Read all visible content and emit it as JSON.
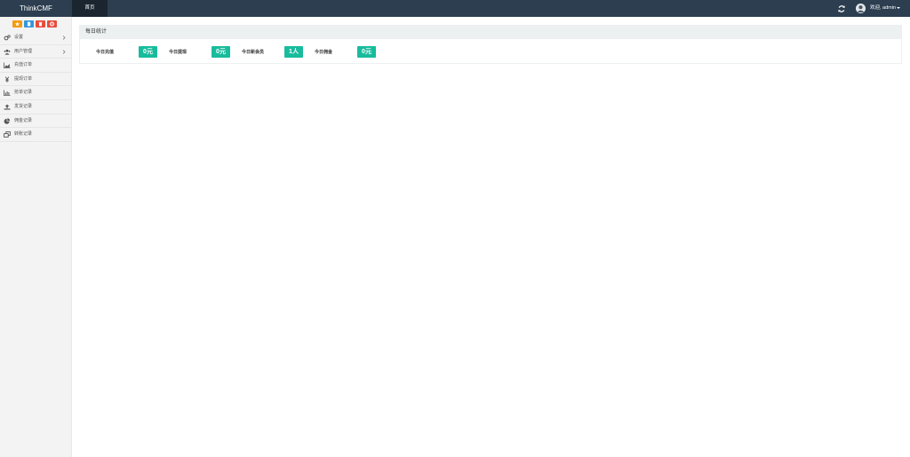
{
  "app": {
    "brand": "ThinkCMF"
  },
  "nav": {
    "tabs": [
      {
        "label": "首页"
      }
    ],
    "user": {
      "greeting": "欢迎, admin"
    }
  },
  "icons": {
    "refresh": "refresh-icon",
    "avatar": "user-avatar-icon",
    "shortcuts": [
      "star-icon",
      "file-icon",
      "trash-icon",
      "gear-icon"
    ]
  },
  "colors": {
    "navbar": "#2c3e50",
    "active_tab": "#1a252f",
    "shortcut_star": "#f39c12",
    "shortcut_file": "#3498db",
    "shortcut_trash": "#e74c3c",
    "shortcut_gear": "#e74c3c",
    "badge": "#18bc9c"
  },
  "sidebar": {
    "items": [
      {
        "label": "设置",
        "icon": "cogs-icon",
        "has_children": true
      },
      {
        "label": "用户管理",
        "icon": "users-icon",
        "has_children": true
      },
      {
        "label": "充值订单",
        "icon": "area-chart-icon",
        "has_children": false
      },
      {
        "label": "提现订单",
        "icon": "yen-icon",
        "has_children": false
      },
      {
        "label": "抢单记录",
        "icon": "bar-chart-icon",
        "has_children": false
      },
      {
        "label": "发货记录",
        "icon": "upload-icon",
        "has_children": false
      },
      {
        "label": "佣金记录",
        "icon": "pie-chart-icon",
        "has_children": false
      },
      {
        "label": "转账记录",
        "icon": "clone-icon",
        "has_children": false
      }
    ]
  },
  "main": {
    "panel_title": "每日统计",
    "stats": [
      {
        "label": "今日充值",
        "value": "0元"
      },
      {
        "label": "今日提现",
        "value": "0元"
      },
      {
        "label": "今日新会员",
        "value": "1人"
      },
      {
        "label": "今日佣金",
        "value": "0元"
      }
    ]
  }
}
